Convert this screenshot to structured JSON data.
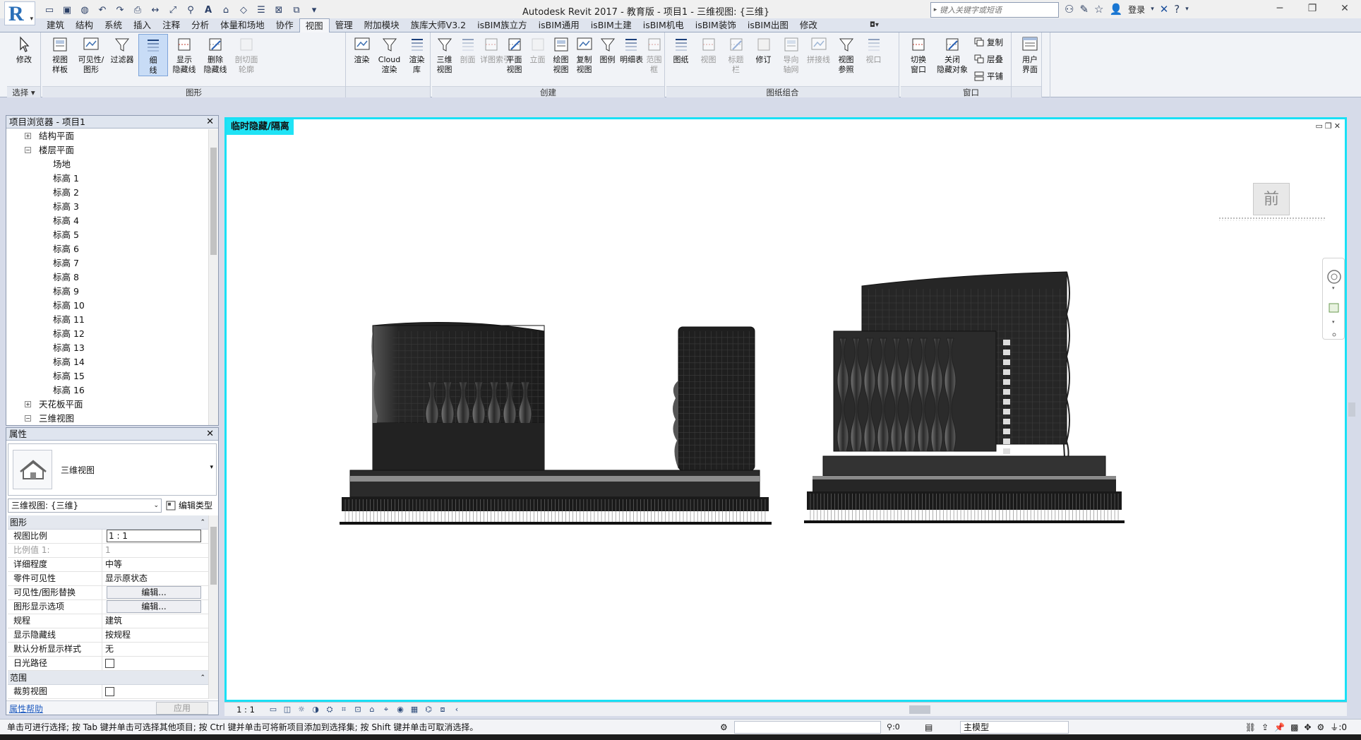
{
  "title_bar": {
    "window_title": "Autodesk Revit 2017 - 教育版 -     项目1 - 三维视图: {三维}",
    "search_placeholder": "键入关键字或短语",
    "login_label": "登录"
  },
  "tabs": [
    "建筑",
    "结构",
    "系统",
    "插入",
    "注释",
    "分析",
    "体量和场地",
    "协作",
    "视图",
    "管理",
    "附加模块",
    "族库大师V3.2",
    "isBIM族立方",
    "isBIM通用",
    "isBIM土建",
    "isBIM机电",
    "isBIM装饰",
    "isBIM出图",
    "修改"
  ],
  "active_tab": "视图",
  "ribbon": {
    "select": {
      "modify": "修改",
      "label": "选择"
    },
    "graphics": {
      "label": "图形",
      "buttons": [
        "视图\n样板",
        "可见性/\n图形",
        "过滤器",
        "细\n线",
        "显示\n隐藏线",
        "删除\n隐藏线",
        "剖切面\n轮廓"
      ]
    },
    "presentation": {
      "buttons": [
        "渲染",
        "Cloud\n渲染",
        "渲染\n库"
      ]
    },
    "create": {
      "label": "创建",
      "buttons": [
        "三维\n视图",
        "剖面",
        "详图索引",
        "平面\n视图",
        "立面",
        "绘图\n视图",
        "复制\n视图",
        "图例",
        "明细表",
        "范围\n框"
      ]
    },
    "sheet": {
      "label": "图纸组合",
      "buttons": [
        "图纸",
        "视图",
        "标题\n栏",
        "修订",
        "导向\n轴网",
        "拼接线",
        "视图\n参照",
        "视口"
      ]
    },
    "windows": {
      "label": "窗口",
      "buttons": [
        "切换\n窗口",
        "关闭\n隐藏对象"
      ],
      "small": [
        "复制",
        "层叠",
        "平铺"
      ],
      "ui": "用户\n界面"
    }
  },
  "project_browser": {
    "title": "项目浏览器 - 项目1",
    "items": [
      {
        "label": "结构平面",
        "level": 1,
        "toggle": "+"
      },
      {
        "label": "楼层平面",
        "level": 1,
        "toggle": "-"
      },
      {
        "label": "场地",
        "level": 2
      },
      {
        "label": "标高 1",
        "level": 2
      },
      {
        "label": "标高 2",
        "level": 2
      },
      {
        "label": "标高 3",
        "level": 2
      },
      {
        "label": "标高 4",
        "level": 2
      },
      {
        "label": "标高 5",
        "level": 2
      },
      {
        "label": "标高 6",
        "level": 2
      },
      {
        "label": "标高 7",
        "level": 2
      },
      {
        "label": "标高 8",
        "level": 2
      },
      {
        "label": "标高 9",
        "level": 2
      },
      {
        "label": "标高 10",
        "level": 2
      },
      {
        "label": "标高 11",
        "level": 2
      },
      {
        "label": "标高 12",
        "level": 2
      },
      {
        "label": "标高 13",
        "level": 2
      },
      {
        "label": "标高 14",
        "level": 2
      },
      {
        "label": "标高 15",
        "level": 2
      },
      {
        "label": "标高 16",
        "level": 2
      },
      {
        "label": "天花板平面",
        "level": 1,
        "toggle": "+"
      },
      {
        "label": "三维视图",
        "level": 1,
        "toggle": "-"
      }
    ]
  },
  "properties": {
    "title": "属性",
    "type_name": "三维视图",
    "view_selector": "三维视图: {三维}",
    "edit_type": "编辑类型",
    "categories": [
      {
        "name": "图形",
        "rows": [
          {
            "name": "视图比例",
            "value": "1 : 1",
            "kind": "input"
          },
          {
            "name": "比例值 1:",
            "value": "1",
            "kind": "disabled"
          },
          {
            "name": "详细程度",
            "value": "中等",
            "kind": "text"
          },
          {
            "name": "零件可见性",
            "value": "显示原状态",
            "kind": "text"
          },
          {
            "name": "可见性/图形替换",
            "value": "编辑...",
            "kind": "button"
          },
          {
            "name": "图形显示选项",
            "value": "编辑...",
            "kind": "button"
          },
          {
            "name": "规程",
            "value": "建筑",
            "kind": "text"
          },
          {
            "name": "显示隐藏线",
            "value": "按规程",
            "kind": "text"
          },
          {
            "name": "默认分析显示样式",
            "value": "无",
            "kind": "text"
          },
          {
            "name": "日光路径",
            "value": "",
            "kind": "checkbox"
          }
        ]
      },
      {
        "name": "范围",
        "rows": [
          {
            "name": "裁剪视图",
            "value": "",
            "kind": "checkbox"
          }
        ]
      }
    ],
    "help_link": "属性帮助",
    "apply": "应用"
  },
  "viewport": {
    "isolate_label": "临时隐藏/隔离",
    "viewcube_face": "前"
  },
  "view_control_bar": {
    "scale": "1 : 1"
  },
  "status_bar": {
    "hint": "单击可进行选择; 按 Tab 键并单击可选择其他项目; 按 Ctrl 键并单击可将新项目添加到选择集; 按 Shift 键并单击可取消选择。",
    "filter_count": ":0",
    "model": "主模型",
    "selection_count": ":0"
  }
}
